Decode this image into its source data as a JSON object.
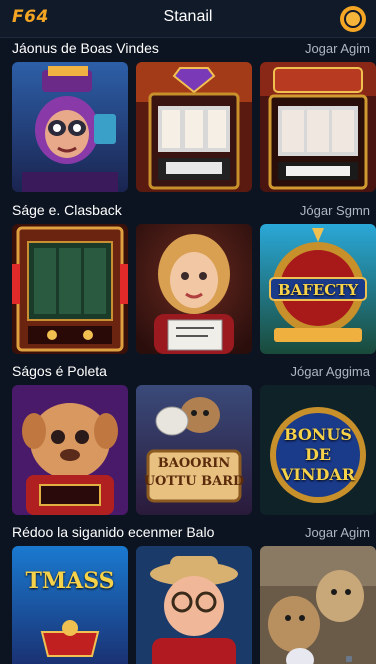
{
  "header": {
    "logo": "F64",
    "title": "Stanail",
    "menu_icon": "coin-menu-icon"
  },
  "sections": [
    {
      "title": "Jáonus de Boas Vindes",
      "link": "Jogar Agim",
      "cards": [
        {
          "icon": "masked-character-thumbnail",
          "label": ""
        },
        {
          "icon": "slot-machine-thumbnail",
          "label": ""
        },
        {
          "icon": "slot-machine-thumbnail",
          "label": ""
        }
      ]
    },
    {
      "title": "Ságe e. Clasback",
      "link": "Jógar Sgmn",
      "cards": [
        {
          "icon": "slot-machine-thumbnail",
          "label": ""
        },
        {
          "icon": "girl-character-thumbnail",
          "label": ""
        },
        {
          "icon": "roulette-badge-thumbnail",
          "label": "BAFECTY"
        }
      ]
    },
    {
      "title": "Ságos é Poleta",
      "link": "Jógar Aggima",
      "cards": [
        {
          "icon": "puppy-character-thumbnail",
          "label": ""
        },
        {
          "icon": "dog-sign-thumbnail",
          "label": "BAOORIN\nUOTTU BARD"
        },
        {
          "icon": "bonus-badge-thumbnail",
          "label": "BONUS\nDE\nVINDAR"
        }
      ]
    },
    {
      "title": "Rédoo la siganido ecenmer Balo",
      "link": "Jogar Agim",
      "cards": [
        {
          "icon": "tmass-title-thumbnail",
          "label": "TMASS"
        },
        {
          "icon": "cowboy-character-thumbnail",
          "label": ""
        },
        {
          "icon": "bears-thumbnail",
          "label": ""
        }
      ]
    }
  ],
  "colors": {
    "background": "#0d1421",
    "accent": "#f3a523"
  }
}
